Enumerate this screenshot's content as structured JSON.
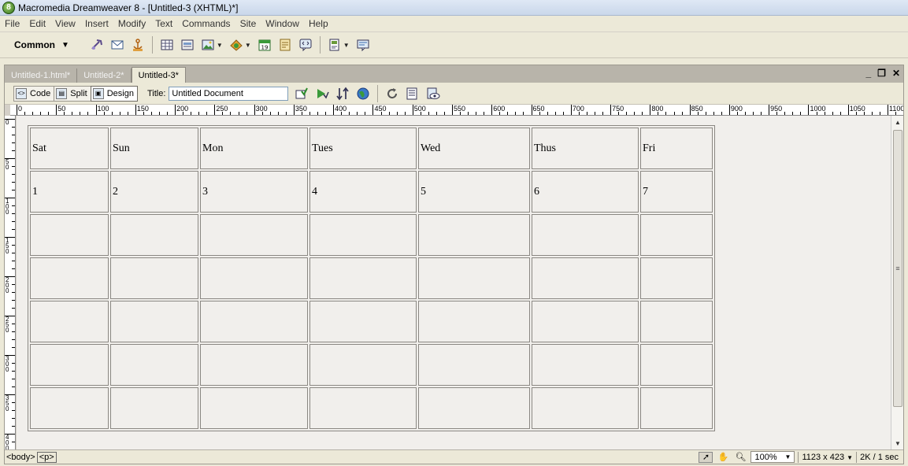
{
  "window": {
    "app_icon": "8",
    "title": "Macromedia Dreamweaver 8 - [Untitled-3 (XHTML)*]"
  },
  "menu": [
    "File",
    "Edit",
    "View",
    "Insert",
    "Modify",
    "Text",
    "Commands",
    "Site",
    "Window",
    "Help"
  ],
  "insert_bar": {
    "category": "Common",
    "icons": [
      "hyperlink-icon",
      "email-link-icon",
      "named-anchor-icon",
      "table-icon",
      "div-icon",
      "image-icon",
      "media-icon",
      "date-icon",
      "server-comment-icon",
      "tag-chooser-icon",
      "templates-icon",
      "tag-inspector-icon"
    ]
  },
  "tabs": [
    {
      "label": "Untitled-1.html*",
      "active": false
    },
    {
      "label": "Untitled-2*",
      "active": false
    },
    {
      "label": "Untitled-3*",
      "active": true
    }
  ],
  "window_controls": {
    "minimize": "_",
    "restore": "❐",
    "close": "✕"
  },
  "doc_toolbar": {
    "code_label": "Code",
    "split_label": "Split",
    "design_label": "Design",
    "title_label": "Title:",
    "title_value": "Untitled Document"
  },
  "ruler_h_labels": [
    "0",
    "50",
    "100",
    "150",
    "200",
    "250",
    "300",
    "350",
    "400",
    "450",
    "500",
    "550",
    "600",
    "650",
    "700",
    "750",
    "800",
    "850",
    "900",
    "950",
    "1000",
    "1050",
    "1100"
  ],
  "ruler_v_labels": [
    "0",
    "5\n0",
    "1\n0\n0",
    "1\n5\n0",
    "2\n0\n0",
    "2\n5\n0",
    "3\n0\n0",
    "3\n5\n0",
    "4\n0\n0"
  ],
  "calendar": {
    "headers": [
      "Sat",
      "Sun",
      "Mon",
      "Tues",
      "Wed",
      "Thus",
      "Fri"
    ],
    "rows": [
      [
        "1",
        "2",
        "3",
        "4",
        "5",
        "6",
        "7"
      ],
      [
        "",
        "",
        "",
        "",
        "",
        "",
        ""
      ],
      [
        "",
        "",
        "",
        "",
        "",
        "",
        ""
      ],
      [
        "",
        "",
        "",
        "",
        "",
        "",
        ""
      ],
      [
        "",
        "",
        "",
        "",
        "",
        "",
        ""
      ],
      [
        "",
        "",
        "",
        "",
        "",
        "",
        ""
      ]
    ]
  },
  "status": {
    "tag_body": "<body>",
    "tag_p": "<p>",
    "zoom": "100%",
    "window_size": "1123 x 423",
    "download": "2K / 1 sec"
  }
}
